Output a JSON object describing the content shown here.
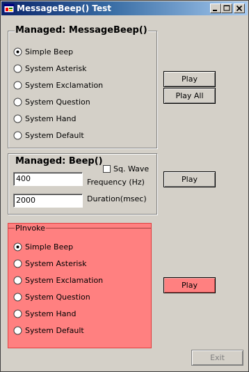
{
  "window": {
    "title": "MessageBeep() Test",
    "icon": "app-window-icon",
    "controls": [
      "minimize-icon",
      "maximize-icon",
      "close-icon"
    ]
  },
  "managed_messagebeep": {
    "title": "Managed: MessageBeep()",
    "options": [
      {
        "label": "Simple Beep",
        "checked": true
      },
      {
        "label": "System Asterisk",
        "checked": false
      },
      {
        "label": "System Exclamation",
        "checked": false
      },
      {
        "label": "System Question",
        "checked": false
      },
      {
        "label": "System Hand",
        "checked": false
      },
      {
        "label": "System Default",
        "checked": false
      }
    ],
    "play_label": "Play",
    "play_all_label": "Play All"
  },
  "managed_beep": {
    "title": "Managed: Beep()",
    "sq_wave_label": "Sq. Wave",
    "sq_wave_checked": false,
    "frequency_value": "400",
    "frequency_label": "Frequency (Hz)",
    "duration_value": "2000",
    "duration_label": "Duration(msec)",
    "play_label": "Play"
  },
  "pinvoke": {
    "title": "PInvoke",
    "accent_color": "#ff8080",
    "options": [
      {
        "label": "Simple Beep",
        "checked": true
      },
      {
        "label": "System Asterisk",
        "checked": false
      },
      {
        "label": "System Exclamation",
        "checked": false
      },
      {
        "label": "System Question",
        "checked": false
      },
      {
        "label": "System Hand",
        "checked": false
      },
      {
        "label": "System Default",
        "checked": false
      }
    ],
    "play_label": "Play"
  },
  "footer": {
    "exit_label": "Exit"
  },
  "colors": {
    "face": "#d4d0c8",
    "title_start": "#0a246a",
    "title_end": "#a6caf0",
    "pinvoke_bg": "#ff8080"
  }
}
